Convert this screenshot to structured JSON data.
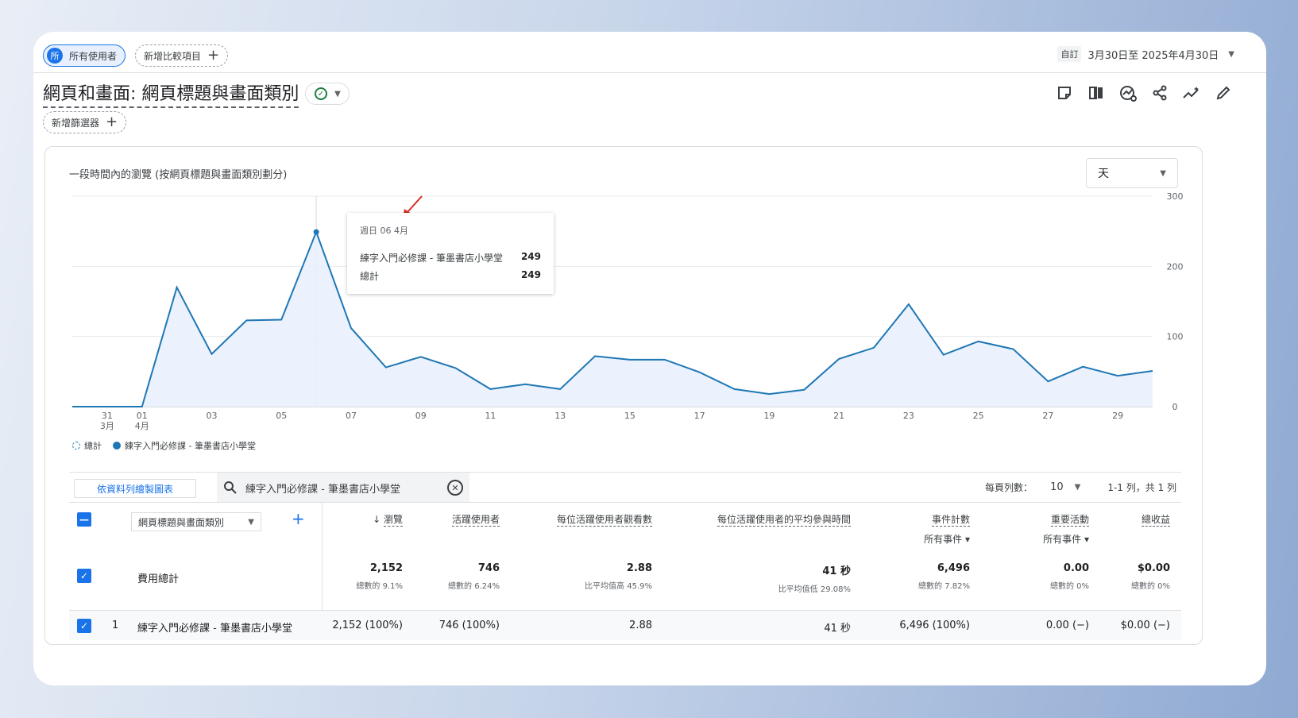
{
  "topbar": {
    "audience_badge": "所",
    "audience_label": "所有使用者",
    "compare_label": "新增比較項目",
    "custom_label": "自訂",
    "date_range": "3月30日至 2025年4月30日"
  },
  "header": {
    "title": "網頁和畫面: 網頁標題與畫面類別",
    "filter_label": "新增篩選器"
  },
  "chart_card": {
    "title": "一段時間內的瀏覽 (按網頁標題與畫面類別劃分)",
    "granularity": "天",
    "tooltip": {
      "date": "週日 06 4月",
      "series_label": "練字入門必修課 - 筆墨書店小學堂",
      "series_value": "249",
      "total_label": "總計",
      "total_value": "249"
    },
    "legend": {
      "total": "總計",
      "series": "練字入門必修課 - 筆墨書店小學堂"
    }
  },
  "chart_data": {
    "type": "area",
    "x_tick_labels": [
      "31",
      "01",
      "03",
      "05",
      "07",
      "09",
      "11",
      "13",
      "15",
      "17",
      "19",
      "21",
      "23",
      "25",
      "27",
      "29"
    ],
    "x_month_labels": [
      "3月",
      "4月"
    ],
    "y_ticks": [
      "0",
      "100",
      "200",
      "300"
    ],
    "ylim": [
      0,
      300
    ],
    "grid": true,
    "legend_position": "bottom-left",
    "series": [
      {
        "name": "練字入門必修課 - 筆墨書店小學堂",
        "color": "#1f77b4",
        "x": [
          "3/30",
          "3/31",
          "4/01",
          "4/02",
          "4/03",
          "4/04",
          "4/05",
          "4/06",
          "4/07",
          "4/08",
          "4/09",
          "4/10",
          "4/11",
          "4/12",
          "4/13",
          "4/14",
          "4/15",
          "4/16",
          "4/17",
          "4/18",
          "4/19",
          "4/20",
          "4/21",
          "4/22",
          "4/23",
          "4/24",
          "4/25",
          "4/26",
          "4/27",
          "4/28",
          "4/29",
          "4/30"
        ],
        "values": [
          0,
          0,
          0,
          170,
          75,
          123,
          124,
          249,
          112,
          56,
          71,
          55,
          25,
          32,
          25,
          72,
          67,
          67,
          49,
          25,
          18,
          24,
          68,
          84,
          146,
          74,
          93,
          82,
          36,
          57,
          44,
          51
        ]
      }
    ],
    "highlight_index": 7
  },
  "table": {
    "plot_button": "依資料列繪製圖表",
    "search_value": "練字入門必修課 - 筆墨書店小學堂",
    "rows_per_page_label": "每頁列數：",
    "rows_per_page_value": "10",
    "pagination": "1-1 列，共 1 列",
    "dimension_label": "網頁標題與畫面類別",
    "headers": {
      "views": "瀏覽",
      "active_users": "活躍使用者",
      "views_per_user": "每位活躍使用者觀看數",
      "avg_engagement": "每位活躍使用者的平均參與時間",
      "event_count": "事件計數",
      "event_count_sub": "所有事件",
      "key_events": "重要活動",
      "key_events_sub": "所有事件",
      "revenue": "總收益"
    },
    "total_row": {
      "label": "費用總計",
      "views": "2,152",
      "views_sub": "總數的 9.1%",
      "active_users": "746",
      "active_users_sub": "總數的 6.24%",
      "views_per_user": "2.88",
      "views_per_user_sub": "比平均值高 45.9%",
      "avg_engagement": "41 秒",
      "avg_engagement_sub": "比平均值低 29.08%",
      "event_count": "6,496",
      "event_count_sub": "總數的 7.82%",
      "key_events": "0.00",
      "key_events_sub": "總數的 0%",
      "revenue": "$0.00",
      "revenue_sub": "總數的 0%"
    },
    "rows": [
      {
        "index": "1",
        "label": "練字入門必修課 - 筆墨書店小學堂",
        "views": "2,152 (100%)",
        "active_users": "746 (100%)",
        "views_per_user": "2.88",
        "avg_engagement": "41 秒",
        "event_count": "6,496 (100%)",
        "key_events": "0.00 (−)",
        "revenue": "$0.00 (−)"
      }
    ]
  }
}
